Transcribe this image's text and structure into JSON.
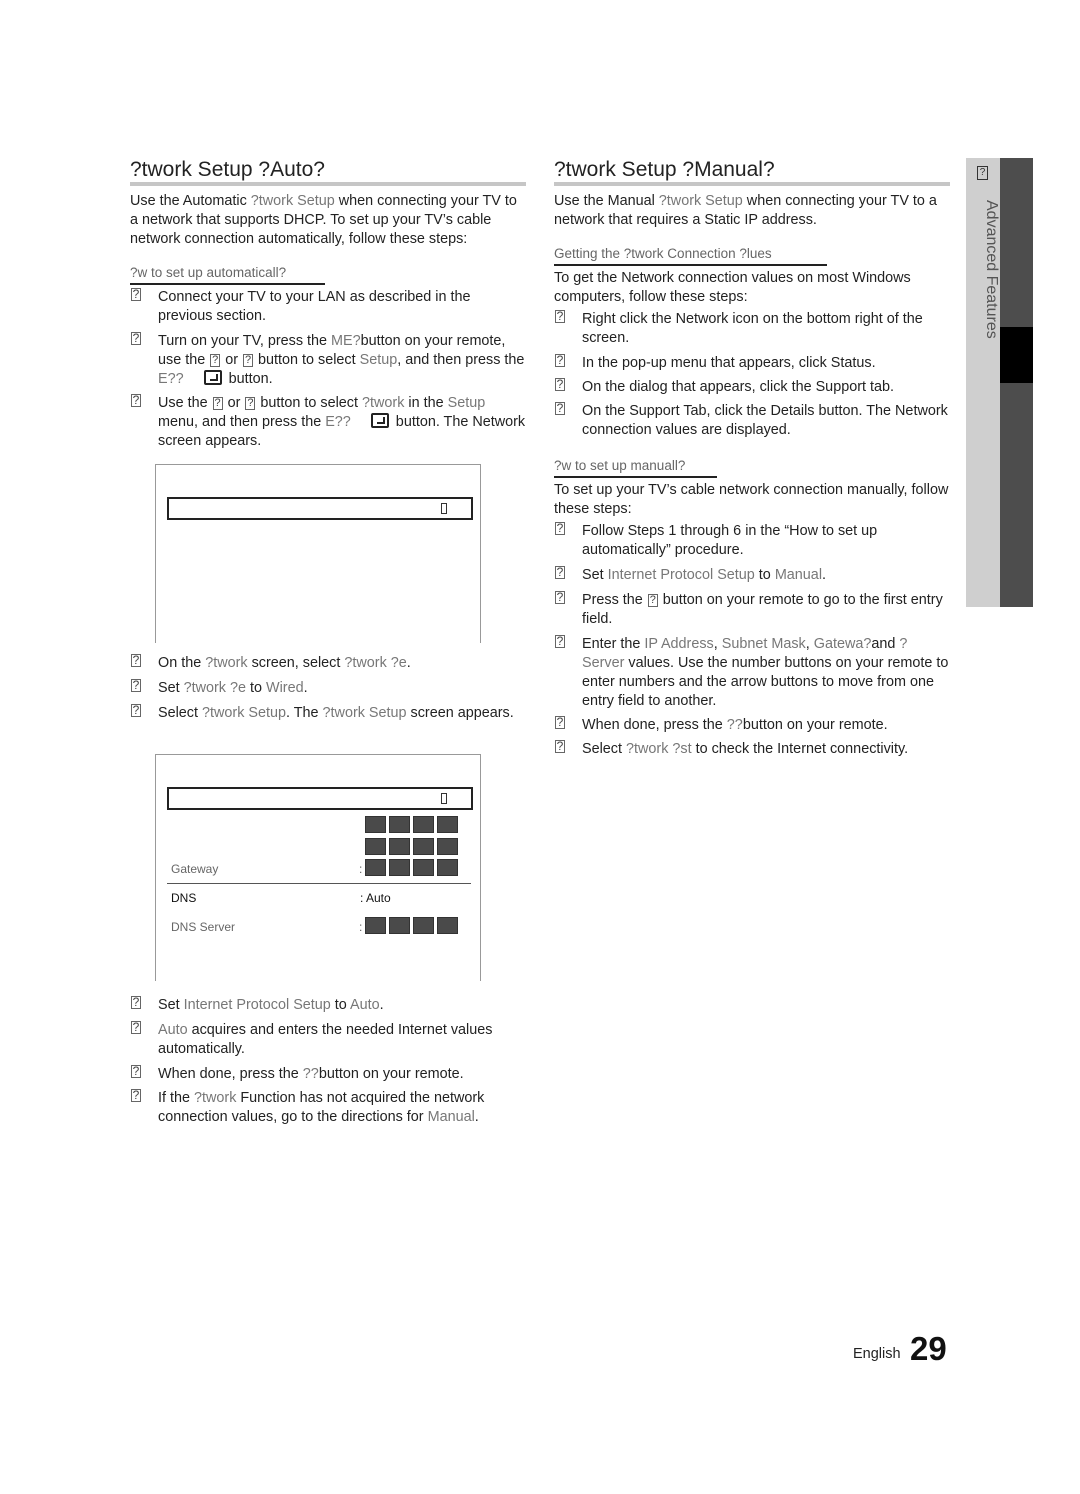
{
  "glyph": "?",
  "left": {
    "title": "?twork Setup ?Auto?",
    "intro": [
      "Use the Automatic ",
      "?twork Setup",
      " when connecting your TV to a network that supports DHCP. To set up your TV’s cable network connection automatically, follow these steps:"
    ],
    "subheading": "?w to set up automaticall?",
    "steps_a": [
      {
        "num": "?",
        "parts": [
          [
            "Connect your TV to your LAN as described in the previous section.",
            ""
          ]
        ]
      },
      {
        "num": "?",
        "parts": [
          [
            "Turn on your TV, press the ",
            ""
          ],
          [
            "ME?",
            "gray"
          ],
          [
            "button on your remote, use the ",
            ""
          ],
          [
            "? ",
            "glyph"
          ],
          [
            " or ",
            ""
          ],
          [
            "? ",
            "glyph"
          ],
          [
            " button to select ",
            ""
          ],
          [
            "Setup",
            "gray"
          ],
          [
            ", and then press the ",
            ""
          ],
          [
            "E??",
            "gray"
          ],
          [
            "enter",
            "enter"
          ],
          [
            " button.",
            ""
          ]
        ]
      },
      {
        "num": "?",
        "parts": [
          [
            "Use the ",
            ""
          ],
          [
            "? ",
            "glyph"
          ],
          [
            " or ",
            ""
          ],
          [
            "? ",
            "glyph"
          ],
          [
            " button to select ",
            ""
          ],
          [
            "?twork",
            "gray"
          ],
          [
            " in the ",
            ""
          ],
          [
            "Setup",
            "gray"
          ],
          [
            " menu, and then press the ",
            ""
          ],
          [
            "E??",
            "gray"
          ],
          [
            "enter",
            "enter"
          ],
          [
            " button. The Network screen appears.",
            ""
          ]
        ]
      }
    ],
    "steps_b": [
      {
        "num": "?",
        "parts": [
          [
            "On the ",
            ""
          ],
          [
            "?twork",
            "gray"
          ],
          [
            " screen, select ",
            ""
          ],
          [
            "?twork ?e",
            "gray"
          ],
          [
            ".",
            ""
          ]
        ]
      },
      {
        "num": "?",
        "parts": [
          [
            "Set ",
            ""
          ],
          [
            "?twork ?e",
            "gray"
          ],
          [
            " to ",
            ""
          ],
          [
            "Wired",
            "gray"
          ],
          [
            ".",
            ""
          ]
        ]
      },
      {
        "num": "?",
        "parts": [
          [
            "Select ",
            ""
          ],
          [
            "?twork Setup",
            "gray"
          ],
          [
            ". The ",
            ""
          ],
          [
            "?twork Setup",
            "gray"
          ],
          [
            " screen appears.",
            ""
          ]
        ]
      }
    ],
    "screen2": {
      "gateway_label": "Gateway",
      "dns_label": "DNS",
      "dns_value": ": Auto",
      "dns_server_label": "DNS Server",
      "colon": ":"
    },
    "steps_c": [
      {
        "num": "?",
        "parts": [
          [
            "Set ",
            ""
          ],
          [
            "Internet Protocol Setup",
            "gray"
          ],
          [
            " to ",
            ""
          ],
          [
            "Auto",
            "gray"
          ],
          [
            ".",
            ""
          ]
        ]
      },
      {
        "num": "?",
        "parts": [
          [
            "Auto",
            "gray"
          ],
          [
            " acquires and enters the needed Internet values automatically.",
            ""
          ]
        ]
      },
      {
        "num": "?",
        "parts": [
          [
            "When done, press the ",
            ""
          ],
          [
            "??",
            "gray"
          ],
          [
            "button on your remote.",
            ""
          ]
        ]
      },
      {
        "num": "?",
        "parts": [
          [
            "If the ",
            ""
          ],
          [
            "?twork",
            "gray"
          ],
          [
            " Function has not acquired the network connection values, go to the directions for ",
            ""
          ],
          [
            "Manual",
            "gray"
          ],
          [
            ".",
            ""
          ]
        ]
      }
    ]
  },
  "right": {
    "title": "?twork Setup ?Manual?",
    "intro": [
      "Use the Manual ",
      "?twork Setup",
      " when connecting your TV to a network that requires a Static IP address."
    ],
    "subheading1": "Getting the ?twork Connection ?lues",
    "para1": "To get the Network connection values on most Windows computers, follow these steps:",
    "steps_a": [
      {
        "num": "?",
        "parts": [
          [
            "Right click the Network icon on the bottom right of the screen.",
            ""
          ]
        ]
      },
      {
        "num": "?",
        "parts": [
          [
            "In the pop-up menu that appears, click Status.",
            ""
          ]
        ]
      },
      {
        "num": "?",
        "parts": [
          [
            "On the dialog that appears, click the Support tab.",
            ""
          ]
        ]
      },
      {
        "num": "?",
        "parts": [
          [
            "On the Support Tab, click the Details button. The Network connection values are displayed.",
            ""
          ]
        ]
      }
    ],
    "subheading2": "?w to set up manuall?",
    "para2": "To set up your TV’s cable network connection manually, follow these steps:",
    "steps_b": [
      {
        "num": "?",
        "parts": [
          [
            "Follow Steps 1 through 6 in the “How to set up automatically” procedure.",
            ""
          ]
        ]
      },
      {
        "num": "?",
        "parts": [
          [
            "Set ",
            ""
          ],
          [
            "Internet Protocol Setup",
            "gray"
          ],
          [
            " to ",
            ""
          ],
          [
            "Manual",
            "gray"
          ],
          [
            ".",
            ""
          ]
        ]
      },
      {
        "num": "?",
        "parts": [
          [
            "Press the ",
            ""
          ],
          [
            "? ",
            "glyph"
          ],
          [
            " button on your remote to go to the first entry field.",
            ""
          ]
        ]
      },
      {
        "num": "?",
        "parts": [
          [
            "Enter the ",
            ""
          ],
          [
            "IP Address",
            "gray"
          ],
          [
            ", ",
            ""
          ],
          [
            "Subnet Mask",
            "gray"
          ],
          [
            ", ",
            ""
          ],
          [
            "Gatewa?",
            "gray"
          ],
          [
            "and ",
            ""
          ],
          [
            "? Server",
            "gray"
          ],
          [
            " values. Use the number buttons on your remote to enter numbers and the arrow buttons to move from one entry field to another.",
            ""
          ]
        ]
      },
      {
        "num": "?",
        "parts": [
          [
            "When done, press the ",
            ""
          ],
          [
            "??",
            "gray"
          ],
          [
            "button on your remote.",
            ""
          ]
        ]
      },
      {
        "num": "?",
        "parts": [
          [
            "Select ",
            ""
          ],
          [
            "?twork ?st",
            "gray"
          ],
          [
            " to check the Internet connectivity.",
            ""
          ]
        ]
      }
    ]
  },
  "sidebar": {
    "chapter_num": "?",
    "chapter_title": "Advanced Features"
  },
  "footer": {
    "language": "English",
    "page_number": "29"
  }
}
